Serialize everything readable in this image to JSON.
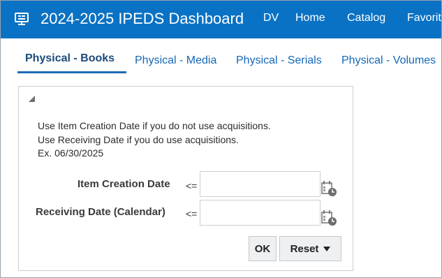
{
  "header": {
    "title": "2024-2025 IPEDS Dashboard",
    "nav": [
      "DV",
      "Home",
      "Catalog",
      "Favorit"
    ]
  },
  "tabs": [
    {
      "label": "Physical - Books",
      "active": true
    },
    {
      "label": "Physical - Media",
      "active": false
    },
    {
      "label": "Physical - Serials",
      "active": false
    },
    {
      "label": "Physical - Volumes",
      "active": false
    }
  ],
  "prompt": {
    "hint_lines": [
      "Use Item Creation Date if you do not use acquisitions.",
      "Use Receiving Date if you do use acquisitions.",
      "Ex. 06/30/2025"
    ],
    "fields": [
      {
        "label": "Item Creation Date",
        "operator": "<=",
        "value": ""
      },
      {
        "label": "Receiving Date (Calendar)",
        "operator": "<=",
        "value": ""
      }
    ],
    "ok_label": "OK",
    "reset_label": "Reset"
  },
  "colors": {
    "header_bg": "#0a72c4",
    "tab_link": "#1468b8",
    "tab_active": "#1c4a7a"
  },
  "icons": {
    "logo": "dashboard-monitor-icon",
    "collapse": "collapse-triangle-icon",
    "calendar": "calendar-clock-icon",
    "reset_menu": "caret-down-icon"
  }
}
